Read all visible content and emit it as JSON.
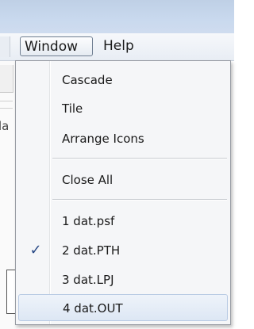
{
  "menubar": {
    "items": [
      {
        "label": "Window"
      },
      {
        "label": "Help"
      }
    ]
  },
  "background": {
    "fragment_text": "la"
  },
  "window_menu": {
    "items": [
      {
        "label": "Cascade"
      },
      {
        "label": "Tile"
      },
      {
        "label": "Arrange Icons"
      },
      {
        "label": "Close All"
      },
      {
        "label": "1 dat.psf",
        "checked": false
      },
      {
        "label": "2 dat.PTH",
        "checked": true
      },
      {
        "label": "3 dat.LPJ",
        "checked": false
      },
      {
        "label": "4 dat.OUT",
        "checked": false,
        "highlighted": true
      }
    ],
    "check_glyph": "✓"
  }
}
